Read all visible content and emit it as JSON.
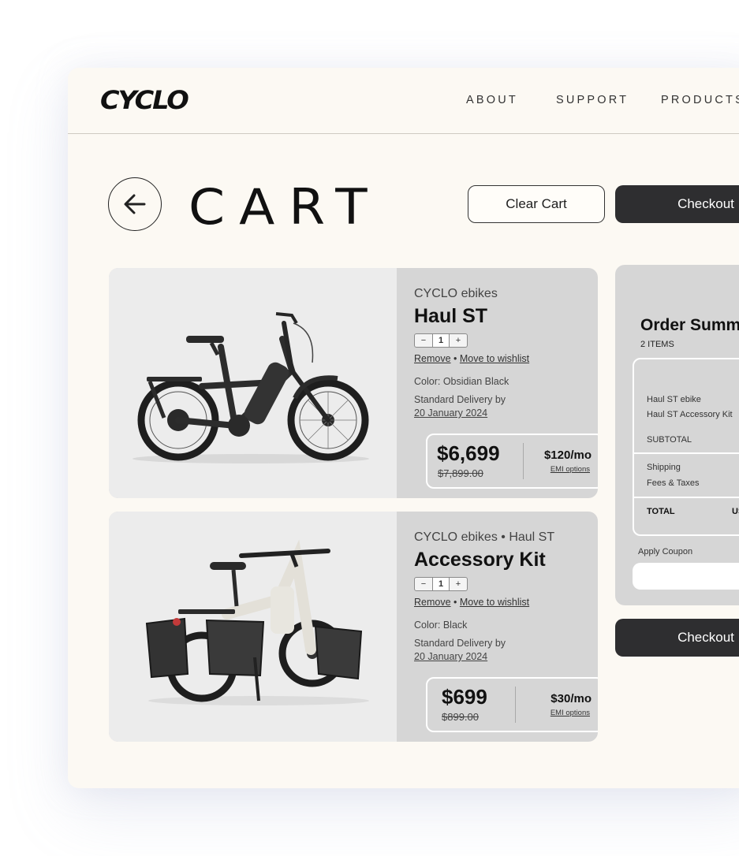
{
  "brand": {
    "logo": "CYCLO"
  },
  "nav": [
    "ABOUT",
    "SUPPORT",
    "PRODUCTS"
  ],
  "page": {
    "title": "CART",
    "clear_label": "Clear Cart",
    "checkout_label": "Checkout"
  },
  "items": [
    {
      "brand": "CYCLO ebikes",
      "name": "Haul ST",
      "qty": "1",
      "remove": "Remove",
      "wishlist": "Move to wishlist",
      "color_label": "Color:",
      "color": "Obsidian Black",
      "delivery_label": "Standard Delivery by",
      "delivery_date": "20 January 2024",
      "price": "$6,699",
      "old_price": "$7,899.00",
      "monthly": "$120/mo",
      "emi": "EMI options"
    },
    {
      "brand": "CYCLO ebikes",
      "brand_sub": "Haul ST",
      "name": "Accessory Kit",
      "qty": "1",
      "remove": "Remove",
      "wishlist": "Move to wishlist",
      "color_label": "Color:",
      "color": "Black",
      "delivery_label": "Standard Delivery by",
      "delivery_date": "20 January 2024",
      "price": "$699",
      "old_price": "$899.00",
      "monthly": "$30/mo",
      "emi": "EMI options"
    }
  ],
  "summary": {
    "title": "Order Summary",
    "count": "2 ITEMS",
    "lines": [
      "Haul ST ebike",
      "Haul ST Accessory Kit"
    ],
    "subtotal": "SUBTOTAL",
    "shipping": "Shipping",
    "fees": "Fees & Taxes",
    "total": "TOTAL",
    "total_value": "USD",
    "coupon_label": "Apply Coupon",
    "checkout_label": "Checkout"
  },
  "colors": {
    "accent_dark": "#2e2e30",
    "page_bg": "#fcf9f3",
    "card_bg": "#d6d6d6"
  }
}
